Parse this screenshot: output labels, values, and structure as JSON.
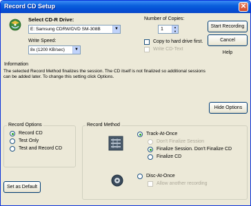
{
  "window": {
    "title": "Record CD Setup"
  },
  "drive": {
    "label": "Select CD-R Drive:",
    "value": "E: Samsung CDRW/DVD SM-308B"
  },
  "speed": {
    "label": "Write Speed:",
    "value": "8x (1200 KB/sec)"
  },
  "copies": {
    "label": "Number of Copies:",
    "value": "1"
  },
  "options": {
    "copy_hard_drive": "Copy to hard drive first.",
    "write_cd_text": "Write CD-Text"
  },
  "buttons": {
    "start": "Start Recording",
    "cancel": "Cancel",
    "help": "Help",
    "hide_options": "Hide Options",
    "set_default": "Set as Default"
  },
  "information": {
    "title": "Information",
    "text": "The selected Record Method finalizes the session. The CD itself is not finalized so additional sessions can be added later. To change this setting click Options."
  },
  "record_options": {
    "title": "Record Options",
    "items": [
      "Record CD",
      "Test Only",
      "Test and Record CD"
    ],
    "selected": "Record CD"
  },
  "record_method": {
    "title": "Record Method",
    "track_at_once": "Track-At-Once",
    "dont_finalize": "Don't Finalize Session",
    "finalize_session": "Finalize Session. Don't Finalize CD",
    "finalize_cd": "Finalize CD",
    "disc_at_once": "Disc-At-Once",
    "allow_another": "Allow another recording"
  },
  "colors": {
    "titlebar": "#0a5fdc",
    "dialog_bg": "#ece9d8",
    "radio_dot": "#21a121"
  }
}
